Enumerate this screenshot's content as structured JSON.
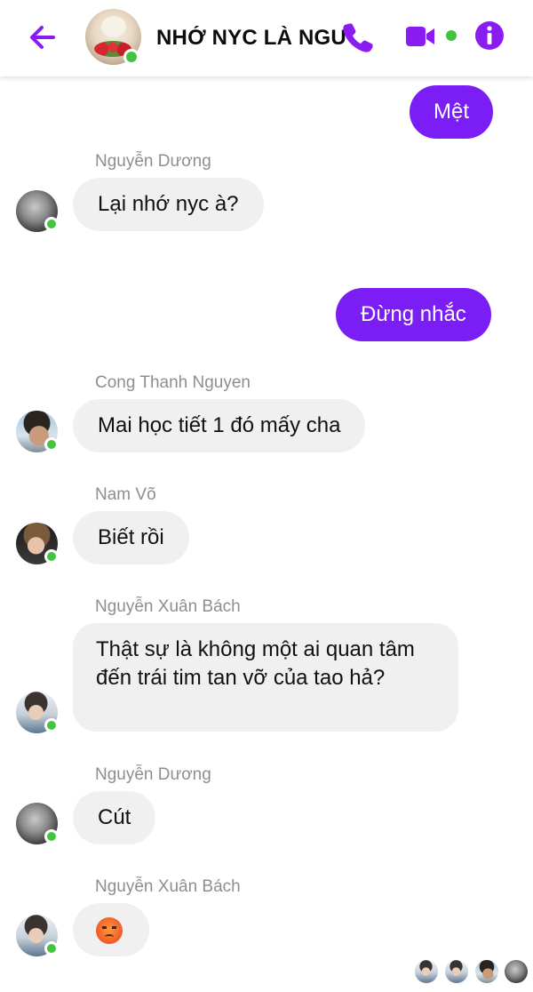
{
  "header": {
    "title": "NHỚ NYC LÀ NGU",
    "back_icon": "arrow-left-icon",
    "call_icon": "phone-icon",
    "video_icon": "video-camera-icon",
    "info_icon": "info-icon",
    "accent_color": "#8a1cf2",
    "online_color": "#44c341"
  },
  "messages": [
    {
      "type": "out",
      "text": "Mệt"
    },
    {
      "type": "in",
      "sender": "Nguyễn Dương",
      "text": "Lại nhớ nyc à?"
    },
    {
      "type": "out",
      "text": "Đừng nhắc"
    },
    {
      "type": "in",
      "sender": "Cong Thanh Nguyen",
      "text": "Mai học tiết 1 đó mấy cha"
    },
    {
      "type": "in",
      "sender": "Nam Võ",
      "text": "Biết rồi"
    },
    {
      "type": "in",
      "sender": "Nguyễn Xuân Bách",
      "text": "Thật sự là không một ai quan tâm đến trái tim tan vỡ của tao hả?"
    },
    {
      "type": "in",
      "sender": "Nguyễn Dương",
      "text": "Cút"
    },
    {
      "type": "in",
      "sender": "Nguyễn Xuân Bách",
      "emoji": "angry-face-emoji"
    }
  ],
  "seen_by_count": 4
}
